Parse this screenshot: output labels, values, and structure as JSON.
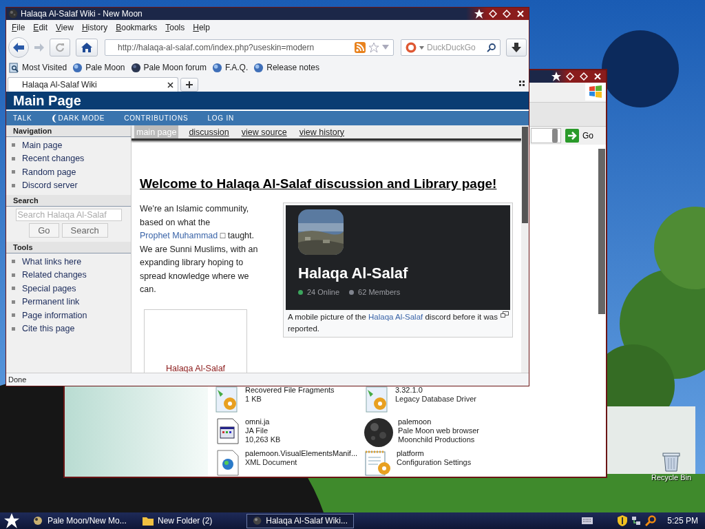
{
  "desktop_icons": [
    {
      "label": "Recycle Bin"
    }
  ],
  "background_window": {
    "go_button": "Go",
    "files": [
      {
        "kind": "component",
        "name": "Recovered File Fragments",
        "details": [
          "1 KB"
        ]
      },
      {
        "kind": "component",
        "name": "3.32.1.0",
        "details": [
          "Legacy Database Driver"
        ]
      },
      {
        "kind": "archive",
        "name": "omni.ja",
        "details": [
          "JA File",
          "10,263 KB"
        ]
      },
      {
        "kind": "app",
        "name": "palemoon",
        "details": [
          "Pale Moon web browser",
          "Moonchild Productions"
        ]
      },
      {
        "kind": "web",
        "name": "palemoon.VisualElementsManif...",
        "details": [
          "XML Document"
        ]
      },
      {
        "kind": "settings",
        "name": "platform",
        "details": [
          "Configuration Settings"
        ]
      }
    ]
  },
  "browser": {
    "title": "Halaqa Al-Salaf Wiki - New Moon",
    "menu": [
      "File",
      "Edit",
      "View",
      "History",
      "Bookmarks",
      "Tools",
      "Help"
    ],
    "url": "http://halaqa-al-salaf.com/index.php?useskin=modern",
    "search_placeholder": "DuckDuckGo",
    "bookmarks": [
      {
        "kind": "search",
        "label": "Most Visited"
      },
      {
        "kind": "globe",
        "label": "Pale Moon"
      },
      {
        "kind": "forum",
        "label": "Pale Moon forum"
      },
      {
        "kind": "globe",
        "label": "F.A.Q."
      },
      {
        "kind": "globe",
        "label": "Release notes"
      }
    ],
    "tabs": [
      {
        "label": "Halaqa Al-Salaf Wiki",
        "selected": true
      }
    ],
    "status": "Done"
  },
  "wiki": {
    "title": "Main Page",
    "actions": [
      {
        "kind": "link",
        "label": "TALK"
      },
      {
        "kind": "toggle",
        "label": "DARK MODE"
      },
      {
        "kind": "link",
        "label": "CONTRIBUTIONS"
      },
      {
        "kind": "link",
        "label": "LOG IN"
      }
    ],
    "sidebar": [
      {
        "kind": "links",
        "heading": "Navigation",
        "items": [
          "Main page",
          "Recent changes",
          "Random page",
          "Discord server"
        ]
      },
      {
        "kind": "search",
        "heading": "Search",
        "placeholder": "Search Halaqa Al-Salaf",
        "buttons": [
          "Go",
          "Search"
        ]
      },
      {
        "kind": "links",
        "heading": "Tools",
        "items": [
          "What links here",
          "Related changes",
          "Special pages",
          "Permanent link",
          "Page information",
          "Cite this page"
        ]
      }
    ],
    "tabs": [
      {
        "label": "main page",
        "selected": true
      },
      {
        "label": "discussion",
        "selected": false
      },
      {
        "label": "view source",
        "selected": false
      },
      {
        "label": "view history",
        "selected": false
      }
    ],
    "heading": "Welcome to Halaqa Al-Salaf discussion and Library page!",
    "intro": {
      "before": "We're an Islamic community, based on what the ",
      "link": "Prophet Muhammad",
      "after": " □ taught. We are Sunni Muslims, with an expanding library hoping to spread knowledge where we can."
    },
    "figure": {
      "server_name": "Halaqa Al-Salaf",
      "stats": [
        {
          "label": "24 Online",
          "color": "#3ba55d"
        },
        {
          "label": "62 Members",
          "color": "#80848e"
        }
      ],
      "caption": {
        "before": "A mobile picture of the ",
        "link": "Halaqa Al-Salaf",
        "after": " discord before it was reported."
      }
    },
    "second_figure": {
      "caption": "Halaqa Al-Salaf"
    }
  },
  "taskbar": {
    "tasks": [
      {
        "kind": "app",
        "label": "Pale Moon/New Mo...",
        "selected": false
      },
      {
        "kind": "folder",
        "label": "New Folder (2)",
        "selected": false
      },
      {
        "kind": "browser",
        "label": "Halaqa Al-Salaf Wiki...",
        "selected": true
      }
    ],
    "clock": "5:25 PM"
  }
}
